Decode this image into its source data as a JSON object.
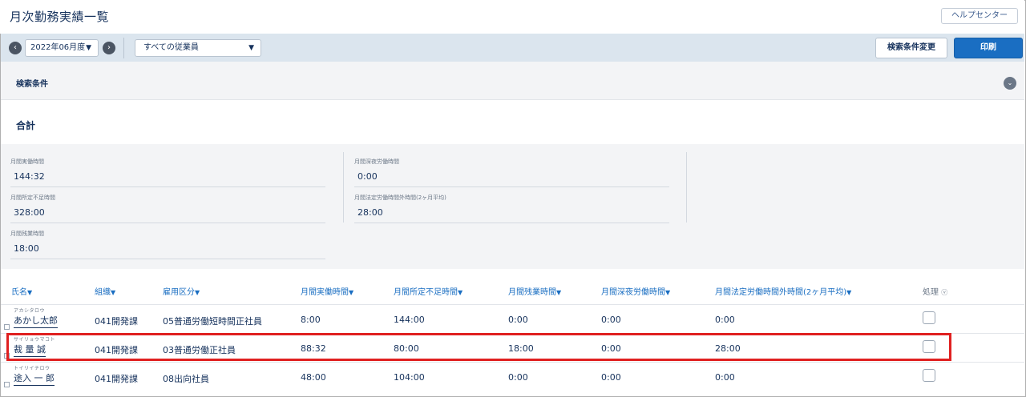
{
  "page": {
    "title": "月次勤務実績一覧",
    "help_label": "ヘルプセンター"
  },
  "toolbar": {
    "prev_icon": "chevron-left-icon",
    "next_icon": "chevron-right-icon",
    "month": "2022年06月度",
    "employee_filter": "すべての従業員",
    "change_condition_label": "検索条件変更",
    "print_label": "印刷",
    "print_color": "#1a6ec2"
  },
  "search": {
    "label": "検索条件"
  },
  "total": {
    "title": "合計",
    "items": [
      {
        "label": "月間実働時間",
        "value": "144:32"
      },
      {
        "label": "月間所定不足時間",
        "value": "328:00"
      },
      {
        "label": "月間残業時間",
        "value": "18:00"
      },
      {
        "label": "月間深夜労働時間",
        "value": "0:00"
      },
      {
        "label": "月間法定労働時間外時間(2ヶ月平均)",
        "value": "28:00"
      }
    ]
  },
  "table": {
    "columns": [
      "氏名",
      "組織",
      "雇用区分",
      "月間実働時間",
      "月間所定不足時間",
      "月間残業時間",
      "月間深夜労働時間",
      "月間法定労働時間外時間(2ヶ月平均)",
      "処理"
    ],
    "rows": [
      {
        "kana": "アカシタロウ",
        "name": "あかし太郎",
        "org": "041開発課",
        "type": "05普通労働短時間正社員",
        "work": "8:00",
        "short": "144:00",
        "over": "0:00",
        "night": "0:00",
        "legal": "0:00"
      },
      {
        "kana": "サイリョウマコト",
        "name": "裁 量 誠",
        "org": "041開発課",
        "type": "03普通労働正社員",
        "work": "88:32",
        "short": "80:00",
        "over": "18:00",
        "night": "0:00",
        "legal": "28:00"
      },
      {
        "kana": "トイリイチロウ",
        "name": "途入 一 郎",
        "org": "041開発課",
        "type": "08出向社員",
        "work": "48:00",
        "short": "104:00",
        "over": "0:00",
        "night": "0:00",
        "legal": "0:00"
      }
    ],
    "highlight_color": "#e02020"
  }
}
